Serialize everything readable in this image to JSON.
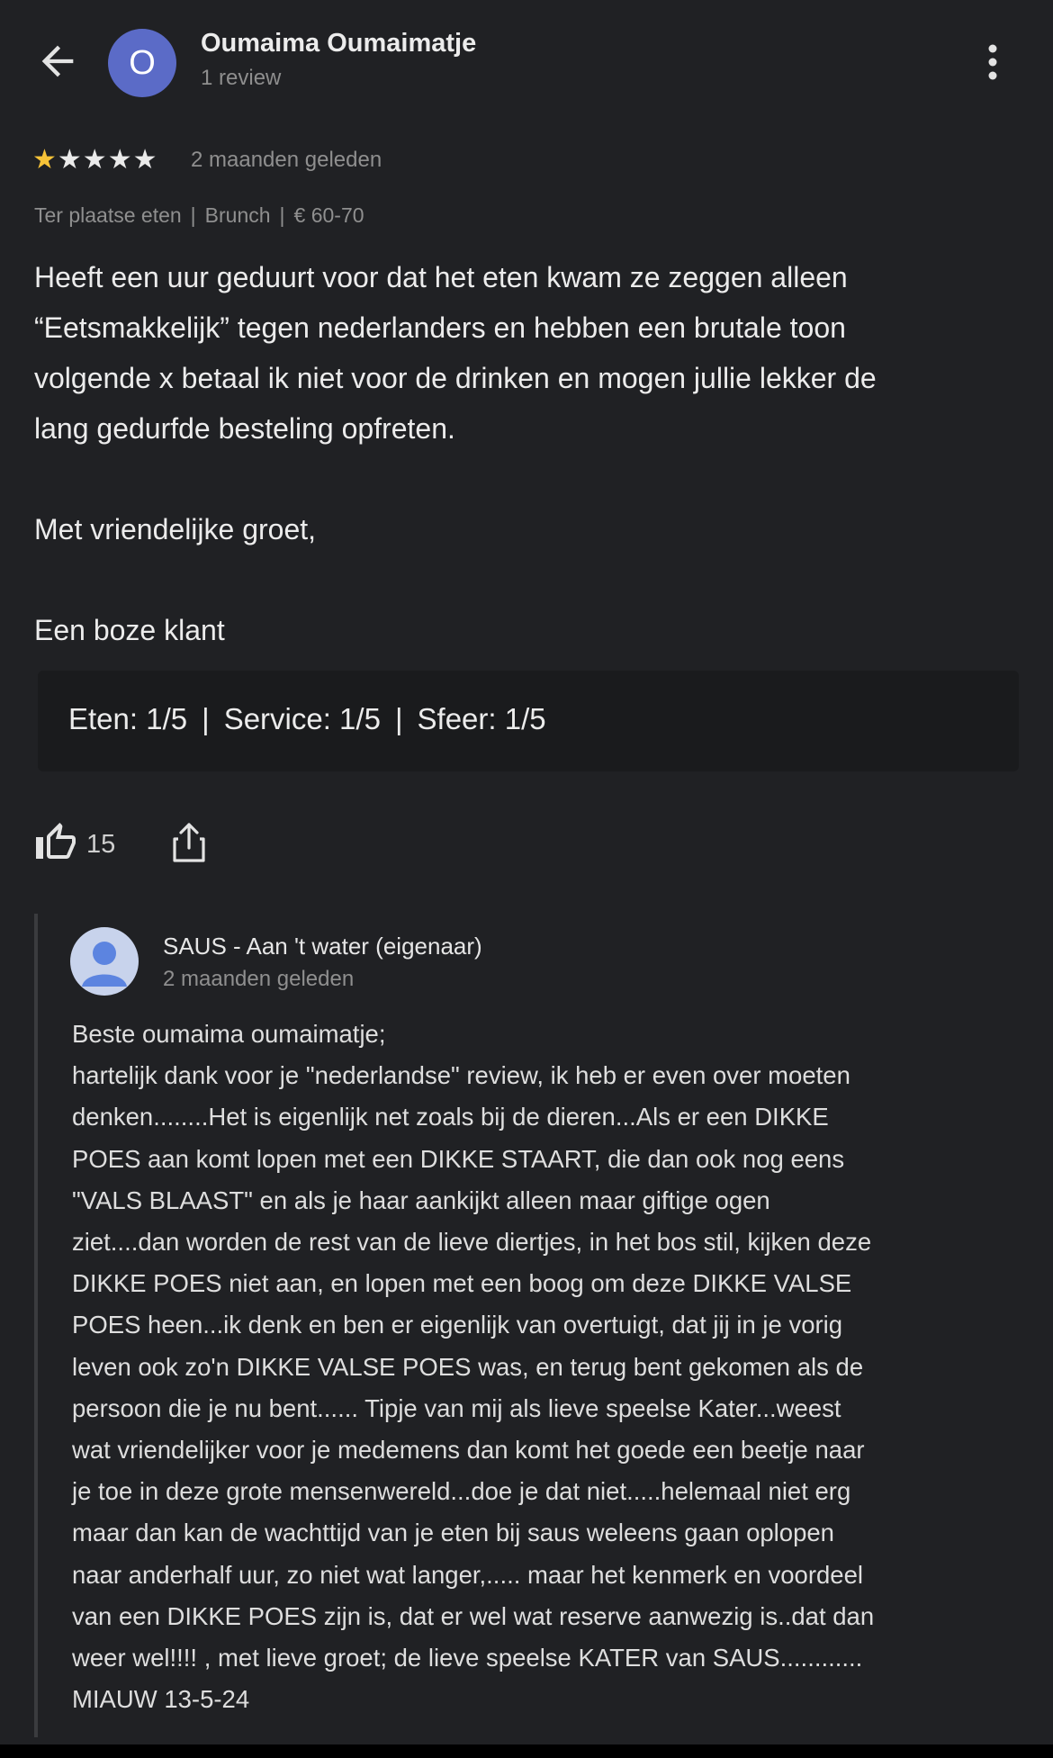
{
  "header": {
    "avatar_letter": "O",
    "user_name": "Oumaima Oumaimatje",
    "user_sub": "1 review",
    "avatar_color": "#5b6bc7"
  },
  "review": {
    "stars": "★★★★★",
    "rating": 1,
    "time": "2 maanden geleden",
    "tags": [
      "Ter plaatse eten",
      "Brunch",
      "€ 60-70"
    ],
    "text": "Heeft een uur geduurt voor dat het eten kwam ze zeggen alleen\n“Eetsmakkelijk” tegen nederlanders en hebben een brutale toon\nvolgende x betaal ik niet voor de drinken en mogen jullie lekker de\nlang gedurfde besteling opfreten.\n\nMet vriendelijke groet,\n\nEen boze klant",
    "ratings": [
      "Eten: 1/5",
      "Service: 1/5",
      "Sfeer: 1/5"
    ],
    "likes": "15"
  },
  "reply": {
    "owner_name": "SAUS - Aan 't water (eigenaar)",
    "time": "2 maanden geleden",
    "text": "Beste oumaima oumaimatje;\nhartelijk dank voor je \"nederlandse\" review, ik heb er even over moeten\ndenken........Het is eigenlijk net zoals bij de dieren...Als er een DIKKE\nPOES aan komt lopen met een DIKKE STAART, die dan ook nog eens\n\"VALS BLAAST\" en als je haar aankijkt alleen maar giftige ogen\nziet....dan worden de rest van de lieve diertjes, in het bos stil, kijken deze\nDIKKE POES niet aan, en lopen met een boog om deze DIKKE VALSE\nPOES heen...ik denk en ben er eigenlijk van overtuigt, dat jij in je vorig\nleven ook zo'n DIKKE VALSE POES was, en terug bent gekomen als de\npersoon die je nu bent...... Tipje van mij als lieve speelse Kater...weest\nwat vriendelijker voor je medemens dan komt het goede een beetje naar\nje toe in deze grote mensenwereld...doe je dat niet.....helemaal niet erg\nmaar dan kan de wachttijd van je eten bij saus weleens gaan oplopen\nnaar anderhalf uur, zo niet wat langer,..... maar het kenmerk en voordeel\nvan een DIKKE POES zijn is, dat er wel wat reserve aanwezig is..dat dan\nweer wel!!!! , met lieve groet; de lieve speelse KATER van SAUS............\nMIAUW 13-5-24"
  },
  "icons": {
    "back": "arrow-left-icon",
    "more": "more-vert-icon",
    "like": "thumb-up-icon",
    "share": "share-icon",
    "owner_avatar": "person-icon"
  },
  "colors": {
    "background": "#202124",
    "star_filled": "#f7c338",
    "owner_avatar_bg": "#c8d3ec",
    "owner_avatar_fg": "#5c84e0"
  }
}
